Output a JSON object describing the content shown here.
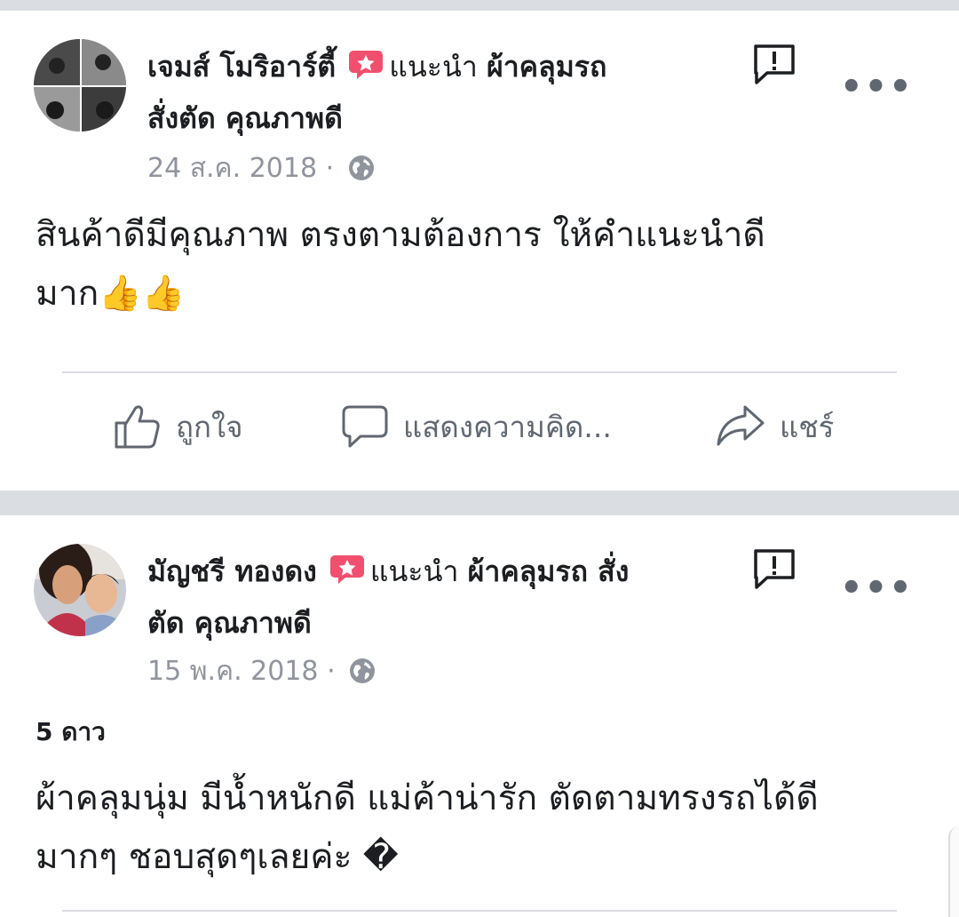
{
  "posts": [
    {
      "author": "เจมส์ โมริอาร์ตี้",
      "recommend_text": "แนะนำ",
      "page_line1": "ผ้าคลุมรถ",
      "page_line2": "สั่งตัด คุณภาพดี",
      "date": "24 ส.ค. 2018",
      "separator": "·",
      "rating": "",
      "text_line1": "สินค้าดีมีคุณภาพ ตรงตามต้องการ ให้คำแนะนำดี",
      "text_line2": "มาก👍👍"
    },
    {
      "author": "มัญชรี ทองดง",
      "recommend_text": "แนะนำ",
      "page_line1": "ผ้าคลุมรถ สั่ง",
      "page_line2": "ตัด คุณภาพดี",
      "date": "15 พ.ค. 2018",
      "separator": "·",
      "rating": "5 ดาว",
      "text_line1": "ผ้าคลุมนุ่ม มีน้ำหนักดี แม่ค้าน่ารัก ตัดตามทรงรถได้ดี",
      "text_line2": "มากๆ ชอบสุดๆเลยค่ะ �"
    }
  ],
  "actions": {
    "like": "ถูกใจ",
    "comment": "แสดงความคิด...",
    "share": "แชร์"
  },
  "more_glyph": "•••",
  "colors": {
    "recommend_badge": "#f0506e",
    "muted": "#90949c",
    "divider": "#dadde1",
    "icon": "#606770"
  },
  "icons": {
    "recommend": "recommend-star-icon",
    "report": "report-exclamation-icon",
    "more": "more-dots-icon",
    "privacy": "globe-icon",
    "like": "thumbs-up-icon",
    "comment": "comment-bubble-icon",
    "share": "share-arrow-icon"
  }
}
